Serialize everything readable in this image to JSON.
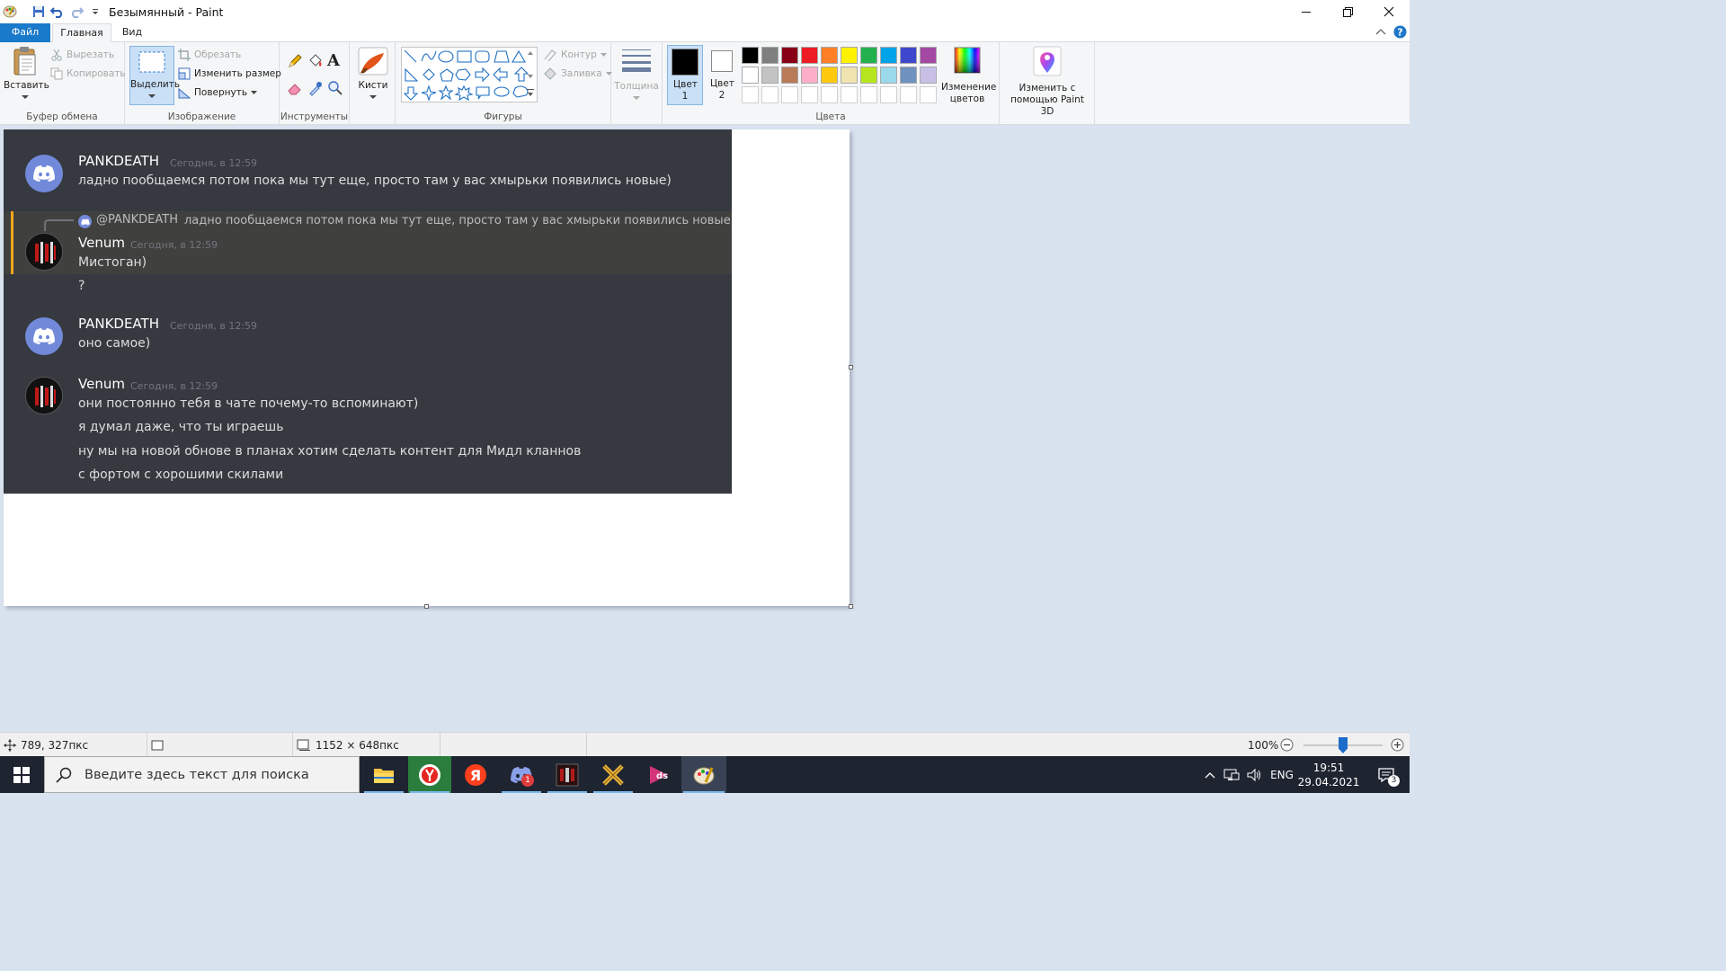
{
  "window": {
    "title": "Безымянный - Paint"
  },
  "tabs": {
    "file": "Файл",
    "home": "Главная",
    "view": "Вид"
  },
  "ribbon": {
    "clipboard": {
      "label": "Буфер обмена",
      "paste": "Вставить",
      "cut": "Вырезать",
      "copy": "Копировать"
    },
    "image": {
      "label": "Изображение",
      "select": "Выделить",
      "crop": "Обрезать",
      "resize": "Изменить размер",
      "rotate": "Повернуть"
    },
    "tools": {
      "label": "Инструменты"
    },
    "brushes": {
      "label": "Кисти"
    },
    "shapes": {
      "label": "Фигуры",
      "outline": "Контур",
      "fill": "Заливка"
    },
    "size": {
      "label": "Толщина"
    },
    "colors": {
      "label": "Цвета",
      "color1": "Цвет 1",
      "color2": "Цвет 2",
      "edit": "Изменение цветов",
      "paint3d": "Изменить с помощью Paint 3D",
      "color1_value": "#000000",
      "color2_value": "#ffffff",
      "palette_row1": [
        "#000000",
        "#7f7f7f",
        "#880015",
        "#ed1c24",
        "#ff7f27",
        "#fff200",
        "#22b14c",
        "#00a2e8",
        "#3f48cc",
        "#a349a4"
      ],
      "palette_row2": [
        "#ffffff",
        "#c3c3c3",
        "#b97a57",
        "#ffaec9",
        "#ffc90e",
        "#efe4b0",
        "#b5e61d",
        "#99d9ea",
        "#7092be",
        "#c8bfe7"
      ]
    }
  },
  "discord": {
    "messages": [
      {
        "author": "PANKDEATH",
        "time": "Сегодня, в 12:59",
        "lines": [
          "ладно пообщаемся потом пока мы тут еще, просто там у вас хмырьки появились новые)"
        ]
      },
      {
        "reply_to": "@PANKDEATH",
        "reply_text": "ладно пообщаемся потом пока мы тут еще, просто там у вас хмырьки появились новые)",
        "author": "Venum",
        "time": "Сегодня, в 12:59",
        "lines": [
          "Мистоган)",
          "?"
        ]
      },
      {
        "author": "PANKDEATH",
        "time": "Сегодня, в 12:59",
        "lines": [
          "оно самое)"
        ]
      },
      {
        "author": "Venum",
        "time": "Сегодня, в 12:59",
        "lines": [
          "они постоянно тебя в чате почему-то вспоминают)",
          "я думал даже, что ты играешь",
          "ну мы на новой обнове в планах хотим сделать контент для Мидл кланнов",
          "с фортом с хорошими скилами"
        ]
      }
    ]
  },
  "statusbar": {
    "cursor_pos": "789, 327пкс",
    "image_size": "1152 × 648пкс",
    "zoom": "100%",
    "zoom_value": 100
  },
  "taskbar": {
    "search_placeholder": "Введите здесь текст для поиска",
    "lang": "ENG",
    "time": "19:51",
    "date": "29.04.2021",
    "notifications": "3",
    "discord_badge": "1"
  }
}
